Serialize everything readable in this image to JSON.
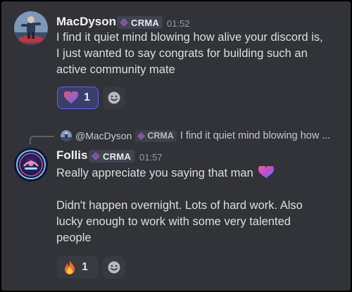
{
  "messages": [
    {
      "author": "MacDyson",
      "tag": "CRMA",
      "time": "01:52",
      "lines": [
        "I find it quiet mind blowing how alive your discord is,",
        "I just wanted to say congrats for building such an",
        "active community mate"
      ],
      "reactions": [
        {
          "emoji": "heart-icon",
          "count": "1",
          "selected": true
        }
      ]
    },
    {
      "author": "Follis",
      "tag": "CRMA",
      "time": "01:57",
      "reply": {
        "author": "@MacDyson",
        "tag": "CRMA",
        "text": "I find it quiet mind blowing how ..."
      },
      "lines": [
        "Really appreciate you saying that man",
        "",
        "Didn't happen overnight. Lots of hard work. Also",
        "lucky enough to work with some very talented",
        "people"
      ],
      "reactions": [
        {
          "emoji": "fire-icon",
          "count": "1",
          "selected": false
        }
      ]
    }
  ],
  "colors": {
    "background": "#323339",
    "author": "#f2f3f5",
    "text": "#dbdee1",
    "timestamp": "#949ba4",
    "accent": "#5865f2"
  }
}
